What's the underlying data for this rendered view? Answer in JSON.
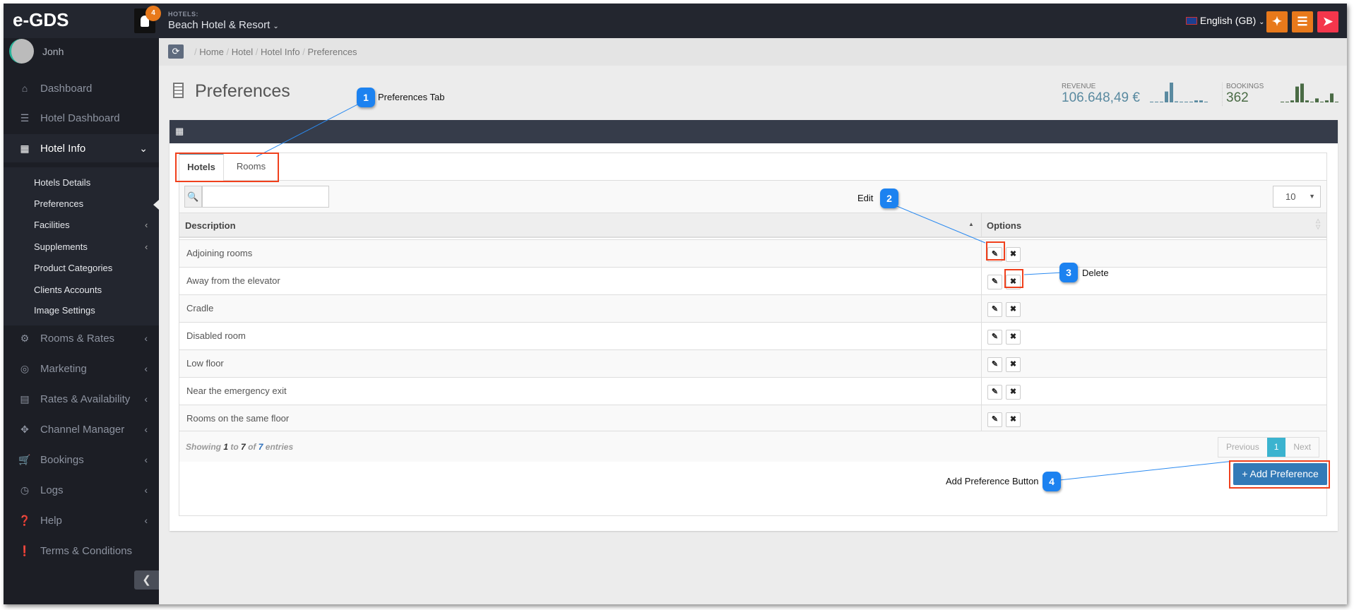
{
  "topbar": {
    "logo": "e-GDS",
    "notification_count": "4",
    "hotels_label": "HOTELS:",
    "hotel_name": "Beach Hotel & Resort",
    "language": "English (GB)",
    "fullscreen_icon": "expand-icon",
    "menu_icon": "bars-icon",
    "logout_icon": "sign-out-icon"
  },
  "colors": {
    "orange": "#e8791b",
    "red": "#f4364c",
    "primary": "#337ab7",
    "page_active": "#3bb3cf",
    "revenue": "#5a8aa0",
    "bookings": "#4a6b45"
  },
  "user": {
    "name": "Jonh"
  },
  "sidebar": {
    "items": [
      {
        "label": "Dashboard",
        "icon": "home-icon"
      },
      {
        "label": "Hotel Dashboard",
        "icon": "tasks-icon"
      },
      {
        "label": "Hotel Info",
        "icon": "building-icon"
      },
      {
        "label": "Rooms & Rates",
        "icon": "cogs-icon"
      },
      {
        "label": "Marketing",
        "icon": "bullseye-icon"
      },
      {
        "label": "Rates & Availability",
        "icon": "bar-chart-icon"
      },
      {
        "label": "Channel Manager",
        "icon": "arrows-icon"
      },
      {
        "label": "Bookings",
        "icon": "cart-icon"
      },
      {
        "label": "Logs",
        "icon": "clock-icon"
      },
      {
        "label": "Help",
        "icon": "question-icon"
      },
      {
        "label": "Terms & Conditions",
        "icon": "exclamation-icon"
      }
    ],
    "subitems": [
      "Hotels Details",
      "Preferences",
      "Facilities",
      "Supplements",
      "Product Categories",
      "Clients Accounts",
      "Image Settings"
    ]
  },
  "breadcrumb": [
    "Home",
    "Hotel",
    "Hotel Info",
    "Preferences"
  ],
  "page": {
    "title": "Preferences"
  },
  "stats": {
    "revenue_label": "REVENUE",
    "revenue_value": "106.648,49 €",
    "bookings_label": "BOOKINGS",
    "bookings_value": "362"
  },
  "tabs": [
    "Hotels",
    "Rooms"
  ],
  "table": {
    "search_value": "",
    "page_length": "10",
    "columns": [
      "Description",
      "Options"
    ],
    "rows": [
      "Adjoining rooms",
      "Away from the elevator",
      "Cradle",
      "Disabled room",
      "Low floor",
      "Near the emergency exit",
      "Rooms on the same floor"
    ],
    "info": {
      "showing": "Showing",
      "from": "1",
      "to_word": "to",
      "to": "7",
      "of_word": "of",
      "total": "7",
      "entries": "entries"
    },
    "pagination": {
      "previous": "Previous",
      "current": "1",
      "next": "Next"
    }
  },
  "add_button": "+ Add Preference",
  "annotations": [
    {
      "number": "1",
      "text": "Preferences Tab"
    },
    {
      "number": "2",
      "text": "Edit"
    },
    {
      "number": "3",
      "text": "Delete"
    },
    {
      "number": "4",
      "text": "Add Preference Button"
    }
  ]
}
